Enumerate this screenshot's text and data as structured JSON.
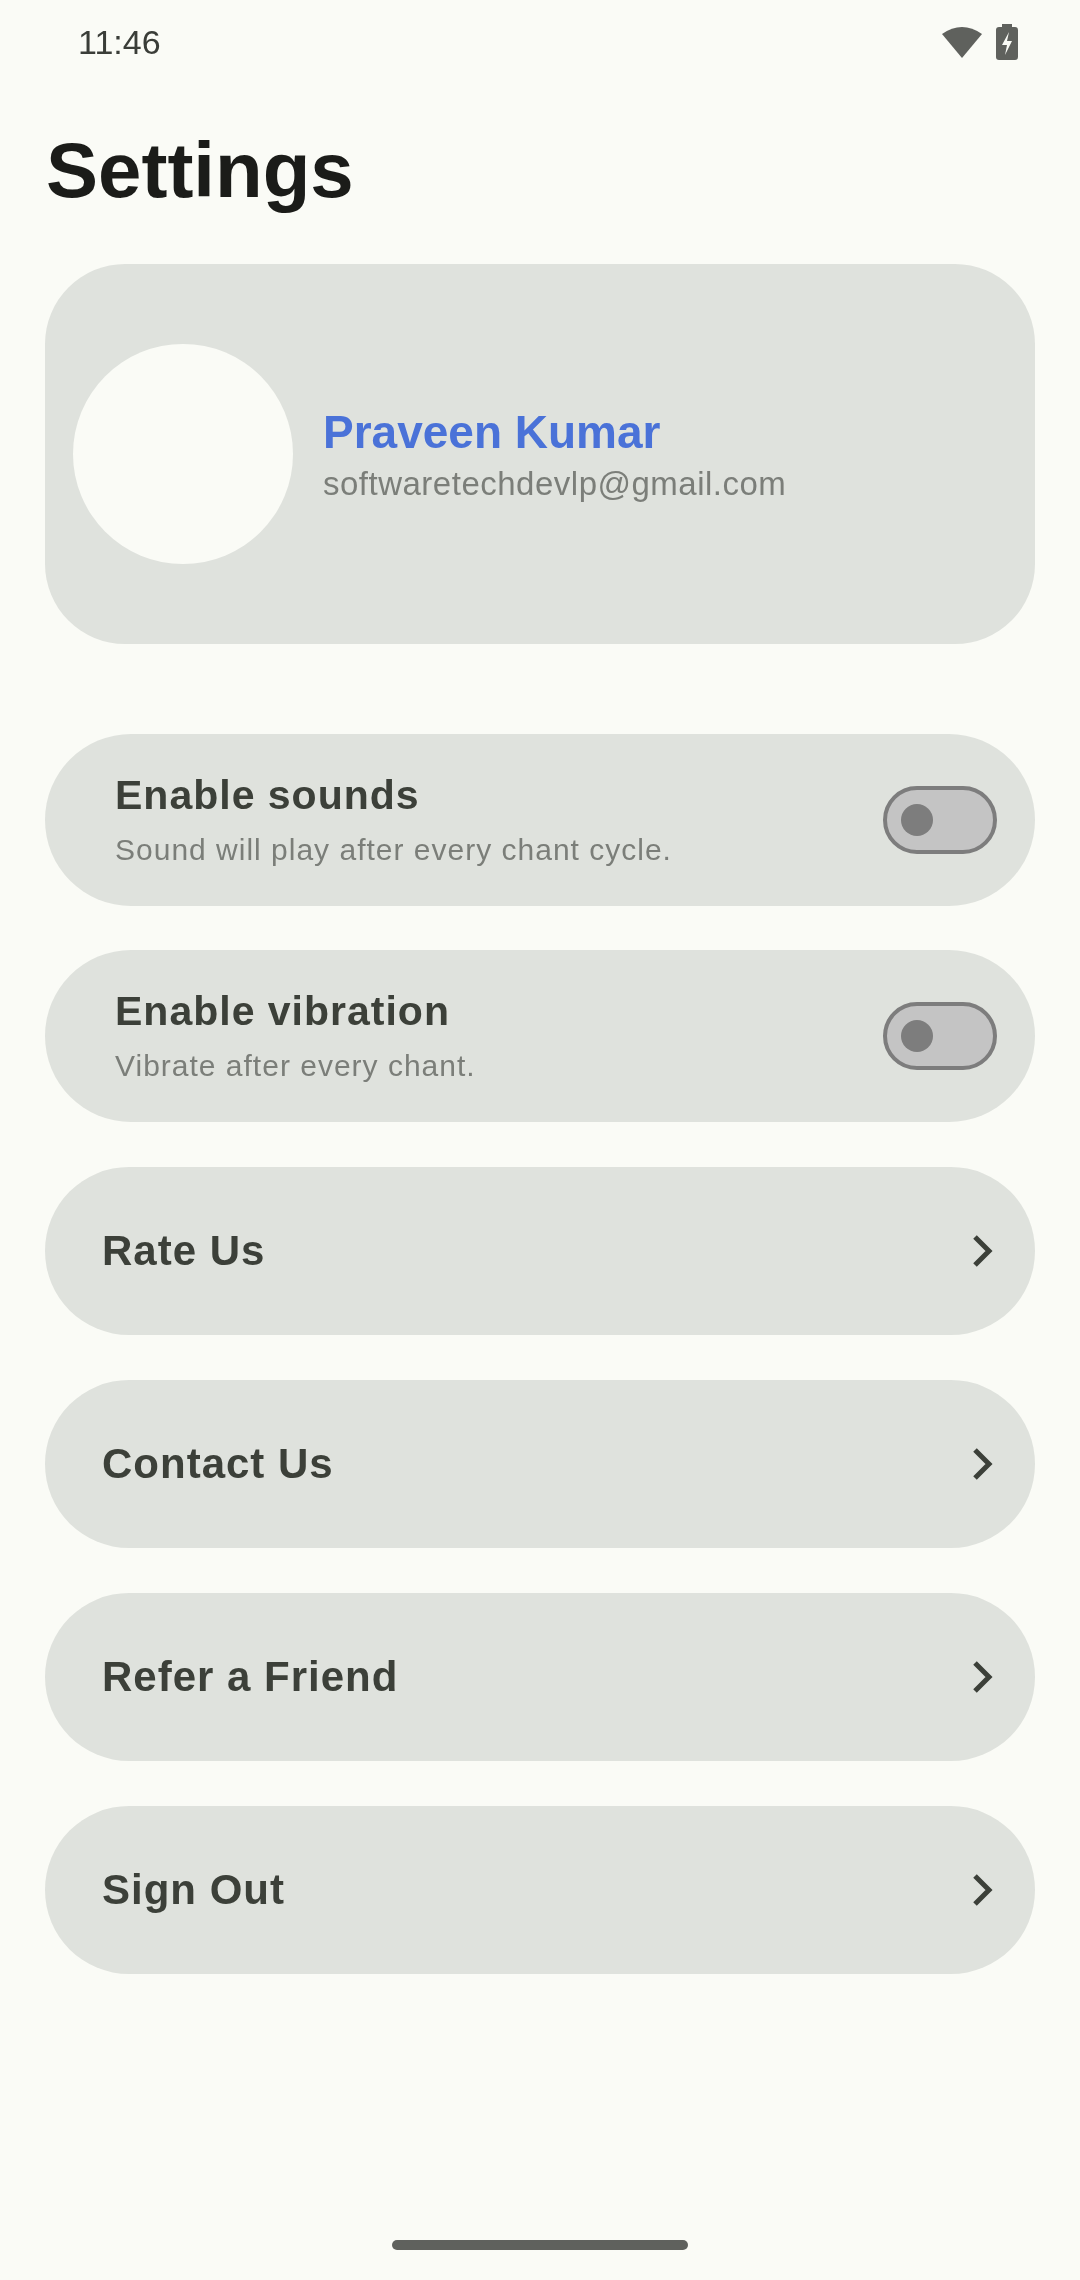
{
  "status_bar": {
    "time": "11:46"
  },
  "title": "Settings",
  "profile": {
    "name": "Praveen Kumar",
    "email": "softwaretechdevlp@gmail.com"
  },
  "items": [
    {
      "kind": "toggle",
      "title": "Enable sounds",
      "subtitle": "Sound will play after every chant cycle.",
      "on": false
    },
    {
      "kind": "toggle",
      "title": "Enable vibration",
      "subtitle": "Vibrate after every chant.",
      "on": false
    },
    {
      "kind": "link",
      "label": "Rate Us"
    },
    {
      "kind": "link",
      "label": "Contact Us"
    },
    {
      "kind": "link",
      "label": "Refer a Friend"
    },
    {
      "kind": "link",
      "label": "Sign Out"
    }
  ]
}
